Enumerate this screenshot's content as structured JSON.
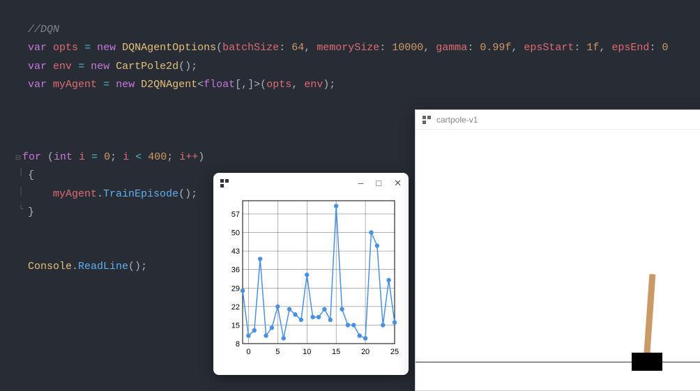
{
  "code": {
    "comment": "//DQN",
    "line1": {
      "var": "var",
      "name": "opts",
      "eq": "=",
      "new": "new",
      "type": "DQNAgentOptions",
      "p1": "batchSize",
      "v1": "64",
      "p2": "memorySize",
      "v2": "10000",
      "p3": "gamma",
      "v3": "0.99f",
      "p4": "epsStart",
      "v4": "1f",
      "p5": "epsEnd",
      "v5": "0"
    },
    "line2": {
      "var": "var",
      "name": "env",
      "eq": "=",
      "new": "new",
      "type": "CartPole2d"
    },
    "line3": {
      "var": "var",
      "name": "myAgent",
      "eq": "=",
      "new": "new",
      "type": "D2QNAgent",
      "generic": "float",
      "args1": "opts",
      "args2": "env"
    },
    "loop": {
      "for": "for",
      "int": "int",
      "i": "i",
      "z": "0",
      "lt": "<",
      "limit": "400",
      "inc": "i++"
    },
    "brace_o": "{",
    "brace_c": "}",
    "call": {
      "obj": "myAgent",
      "method": "TrainEpisode"
    },
    "console": {
      "obj": "Console",
      "method": "ReadLine"
    }
  },
  "chart_window": {
    "minimize": "—",
    "maximize": "□",
    "close": "✕"
  },
  "chart_data": {
    "type": "line",
    "x": [
      -1,
      0,
      1,
      2,
      3,
      4,
      5,
      6,
      7,
      8,
      9,
      10,
      11,
      12,
      13,
      14,
      15,
      16,
      17,
      18,
      19,
      20,
      21,
      22,
      23,
      24,
      25
    ],
    "values": [
      28,
      11,
      13,
      40,
      11,
      14,
      22,
      10,
      21,
      19,
      17,
      34,
      18,
      18,
      21,
      17,
      60,
      21,
      15,
      15,
      11,
      10,
      50,
      45,
      15,
      32,
      16
    ],
    "y_ticks": [
      8,
      15,
      22,
      29,
      36,
      43,
      50,
      57
    ],
    "x_ticks": [
      0,
      5,
      10,
      15,
      20,
      25
    ],
    "xlim": [
      -1,
      25
    ],
    "ylim": [
      8,
      62
    ],
    "title": "",
    "xlabel": "",
    "ylabel": "",
    "legend": false
  },
  "cartpole": {
    "title": "cartpole-v1"
  }
}
